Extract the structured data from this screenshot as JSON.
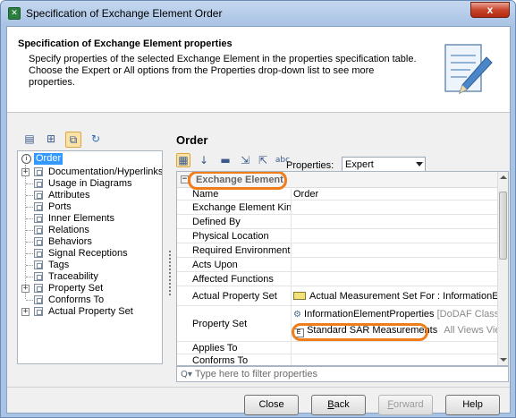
{
  "window": {
    "title": "Specification of Exchange Element Order",
    "close_glyph": "x"
  },
  "header": {
    "title": "Specification of Exchange Element properties",
    "description": "Specify properties of the selected Exchange Element in the properties specification table. Choose the Expert or All options from the Properties drop-down list to see more properties.",
    "icon": "document-pencil-icon"
  },
  "tree": {
    "root_label": "Order",
    "items": [
      {
        "label": "Documentation/Hyperlinks",
        "expandable": true
      },
      {
        "label": "Usage in Diagrams",
        "expandable": false
      },
      {
        "label": "Attributes",
        "expandable": false
      },
      {
        "label": "Ports",
        "expandable": false
      },
      {
        "label": "Inner Elements",
        "expandable": false
      },
      {
        "label": "Relations",
        "expandable": false
      },
      {
        "label": "Behaviors",
        "expandable": false
      },
      {
        "label": "Signal Receptions",
        "expandable": false
      },
      {
        "label": "Tags",
        "expandable": false
      },
      {
        "label": "Traceability",
        "expandable": false
      },
      {
        "label": "Property Set",
        "expandable": true
      },
      {
        "label": "Conforms To",
        "expandable": false
      },
      {
        "label": "Actual Property Set",
        "expandable": true
      }
    ]
  },
  "main": {
    "element_title": "Order",
    "properties_label": "Properties:",
    "properties_selected": "Expert",
    "group_title": "Exchange Element",
    "rows": [
      {
        "name": "Name",
        "value": "Order"
      },
      {
        "name": "Exchange Element Kind",
        "value": ""
      },
      {
        "name": "Defined By",
        "value": ""
      },
      {
        "name": "Physical Location",
        "value": ""
      },
      {
        "name": "Required Environment",
        "value": ""
      },
      {
        "name": "Acts Upon",
        "value": ""
      },
      {
        "name": "Affected Functions",
        "value": ""
      },
      {
        "name": "Actual Property Set",
        "value": "Actual Measurement Set For : InformationEleme"
      },
      {
        "name": "Property Set",
        "value": "InformationElementProperties",
        "value_note": "[DoDAF Class Libr",
        "value2": "Standard SAR Measurements",
        "value2_note": "All Views Viewpoi"
      },
      {
        "name": "Applies To",
        "value": ""
      },
      {
        "name": "Conforms To",
        "value": ""
      }
    ],
    "filter_placeholder": "Type here to filter properties"
  },
  "buttons": {
    "close": "Close",
    "back_hot": "B",
    "back_rest": "ack",
    "forward_hot": "F",
    "forward_rest": "orward",
    "help": "Help"
  },
  "colors": {
    "highlight": "#ef7d1a",
    "selection": "#3399ff"
  }
}
